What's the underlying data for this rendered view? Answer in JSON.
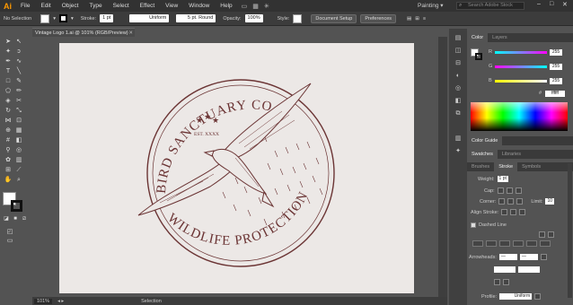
{
  "app": {
    "logo": "Ai",
    "menu": [
      "File",
      "Edit",
      "Object",
      "Type",
      "Select",
      "Effect",
      "View",
      "Window",
      "Help"
    ],
    "workspace": "Painting",
    "search_placeholder": "Search Adobe Stock"
  },
  "controlbar": {
    "selection": "No Selection",
    "stroke_label": "Stroke:",
    "stroke_weight": "1 pt",
    "profile": "Uniform",
    "brush": "5 pt. Round",
    "opacity_label": "Opacity:",
    "opacity": "100%",
    "style_label": "Style:",
    "doc_setup": "Document Setup",
    "preferences": "Preferences"
  },
  "document": {
    "tab_title": "Vintage Logo 1.ai @ 101% (RGB/Preview)",
    "zoom": "101%",
    "status": "Selection"
  },
  "artwork": {
    "top_text": "BIRD SANCTUARY CO.",
    "bottom_text": "WILDLIFE PROTECTION",
    "est": "EST. XXXX",
    "ink_color": "#6b3434"
  },
  "color_panel": {
    "tabs": [
      "Color",
      "Layers"
    ],
    "channels": [
      {
        "name": "R",
        "value": "255",
        "color": "#ff2a2a"
      },
      {
        "name": "G",
        "value": "255",
        "color": "#1aa81a"
      },
      {
        "name": "B",
        "value": "255",
        "color": "#2a5aff"
      }
    ],
    "hex_prefix": "#",
    "hex": "ffffff"
  },
  "guide_panel": {
    "title": "Color Guide"
  },
  "swatches_panel": {
    "tabs": [
      "Swatches",
      "Libraries"
    ]
  },
  "stroke_panel": {
    "tabs": [
      "Brushes",
      "Stroke",
      "Symbols"
    ],
    "weight_label": "Weight:",
    "weight": "1 pt",
    "cap_label": "Cap:",
    "corner_label": "Corner:",
    "limit_label": "Limit:",
    "limit": "10",
    "align_label": "Align Stroke:",
    "dashed_label": "Dashed Line",
    "arrowheads_label": "Arrowheads:",
    "profile_label": "Profile:",
    "profile": "Uniform"
  }
}
